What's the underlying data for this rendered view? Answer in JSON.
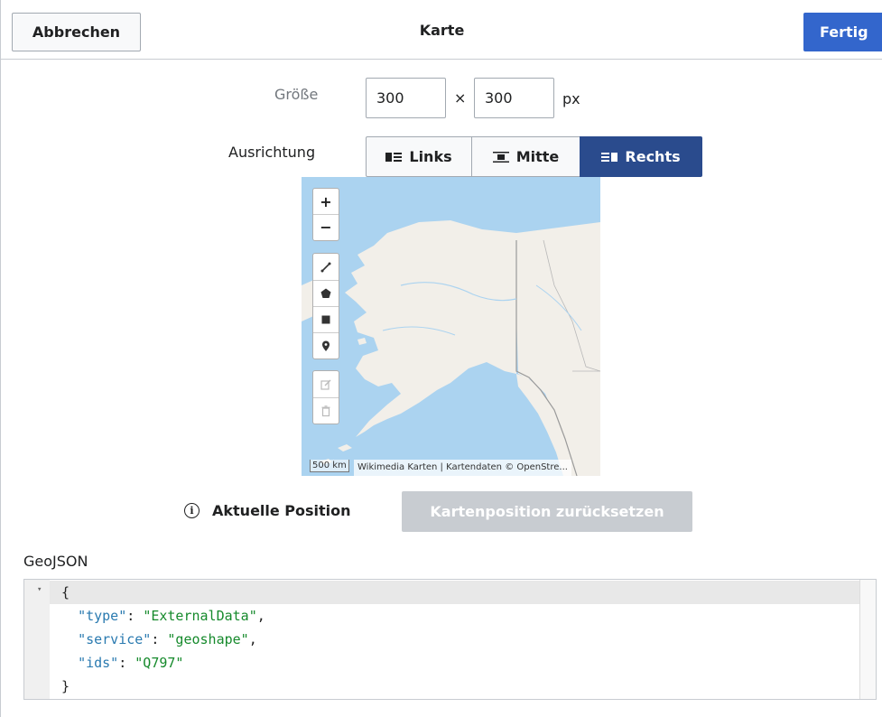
{
  "header": {
    "cancel_label": "Abbrechen",
    "title": "Karte",
    "done_label": "Fertig"
  },
  "size": {
    "label": "Größe",
    "width": "300",
    "times": "×",
    "height": "300",
    "unit": "px"
  },
  "alignment": {
    "label": "Ausrichtung",
    "options": [
      {
        "label": "Links",
        "selected": false
      },
      {
        "label": "Mitte",
        "selected": false
      },
      {
        "label": "Rechts",
        "selected": true
      }
    ]
  },
  "map": {
    "zoom_in": "+",
    "zoom_out": "−",
    "tools": [
      "polyline-icon",
      "polygon-icon",
      "rectangle-icon",
      "marker-icon"
    ],
    "edit_tools": [
      "edit-icon",
      "delete-icon"
    ],
    "scale": "500 km",
    "attribution": "Wikimedia Karten | Kartendaten © OpenStre..."
  },
  "position": {
    "info_icon": "info-icon",
    "label": "Aktuelle Position",
    "reset_label": "Kartenposition zurücksetzen"
  },
  "geojson": {
    "label": "GeoJSON",
    "code": {
      "open": "{",
      "type_key": "\"type\"",
      "type_value": "\"ExternalData\"",
      "service_key": "\"service\"",
      "service_value": "\"geoshape\"",
      "ids_key": "\"ids\"",
      "ids_value": "\"Q797\"",
      "close": "}"
    }
  },
  "colors": {
    "accent": "#3366cc",
    "selected": "#2a4b8d",
    "disabled": "#c8ccd1",
    "water": "#abd3f0",
    "land": "#f2efe9"
  }
}
